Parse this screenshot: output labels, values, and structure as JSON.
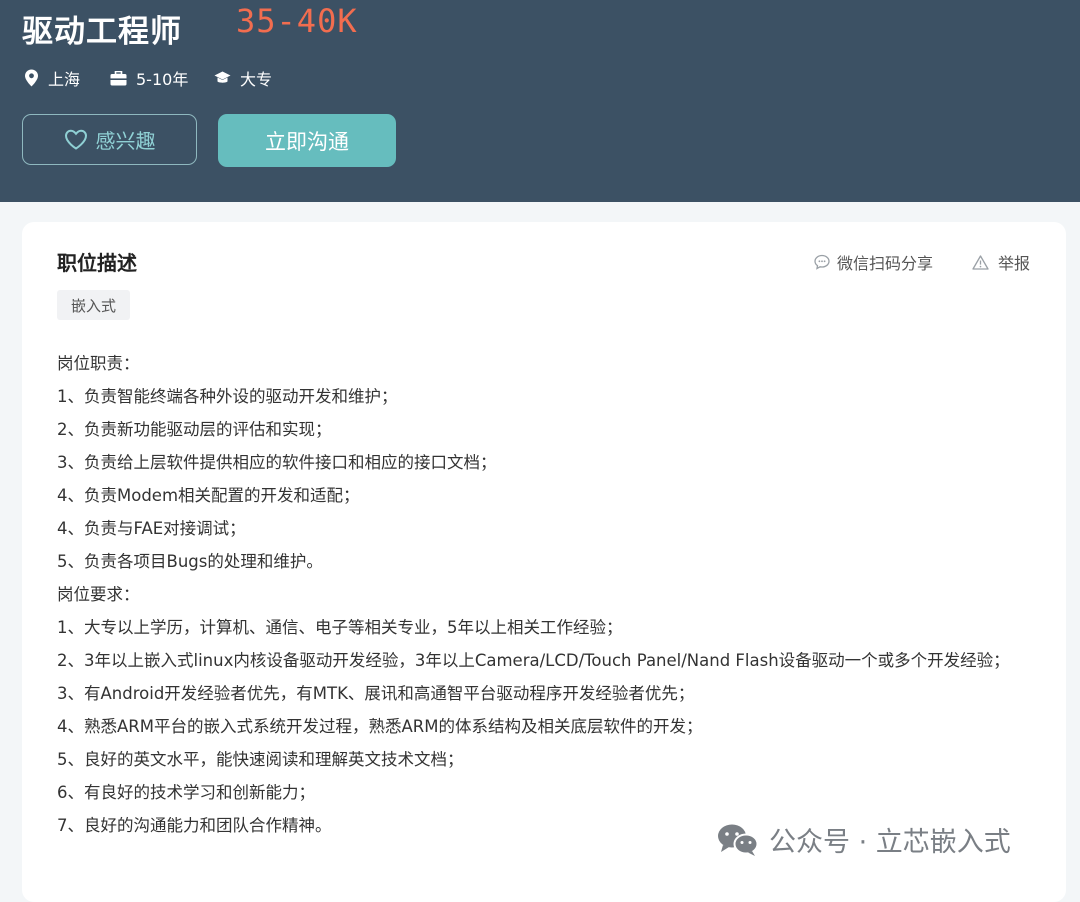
{
  "job": {
    "title": "驱动工程师",
    "salary": "35-40K",
    "location": "上海",
    "experience": "5-10年",
    "education": "大专",
    "icons": {
      "location": "location-pin-icon",
      "experience": "briefcase-icon",
      "education": "graduation-cap-icon"
    }
  },
  "actions": {
    "interest_label": "感兴趣",
    "interest_icon": "heart-outline-icon",
    "chat_label": "立即沟通"
  },
  "description": {
    "title": "职位描述",
    "share_label": "微信扫码分享",
    "share_icon": "chat-bubble-icon",
    "report_label": "举报",
    "report_icon": "warning-triangle-icon",
    "tag": "嵌入式",
    "lines": [
      "岗位职责：",
      "1、负责智能终端各种外设的驱动开发和维护；",
      "2、负责新功能驱动层的评估和实现；",
      "3、负责给上层软件提供相应的软件接口和相应的接口文档；",
      "4、负责Modem相关配置的开发和适配；",
      "4、负责与FAE对接调试；",
      "5、负责各项目Bugs的处理和维护。",
      "岗位要求：",
      "1、大专以上学历，计算机、通信、电子等相关专业，5年以上相关工作经验；",
      "2、3年以上嵌入式linux内核设备驱动开发经验，3年以上Camera/LCD/Touch Panel/Nand Flash设备驱动一个或多个开发经验；",
      "3、有Android开发经验者优先，有MTK、展讯和高通智平台驱动程序开发经验者优先；",
      "4、熟悉ARM平台的嵌入式系统开发过程，熟悉ARM的体系结构及相关底层软件的开发；",
      "5、良好的英文水平，能快速阅读和理解英文技术文档；",
      "6、有良好的技术学习和创新能力；",
      "7、良好的沟通能力和团队合作精神。"
    ]
  },
  "watermark": {
    "text": "公众号 · 立芯嵌入式",
    "icon": "wechat-icon"
  },
  "colors": {
    "header_bg": "#3c5164",
    "salary": "#f26d4f",
    "chat_button": "#66bdbe",
    "interest_text": "#8fd0d4"
  }
}
